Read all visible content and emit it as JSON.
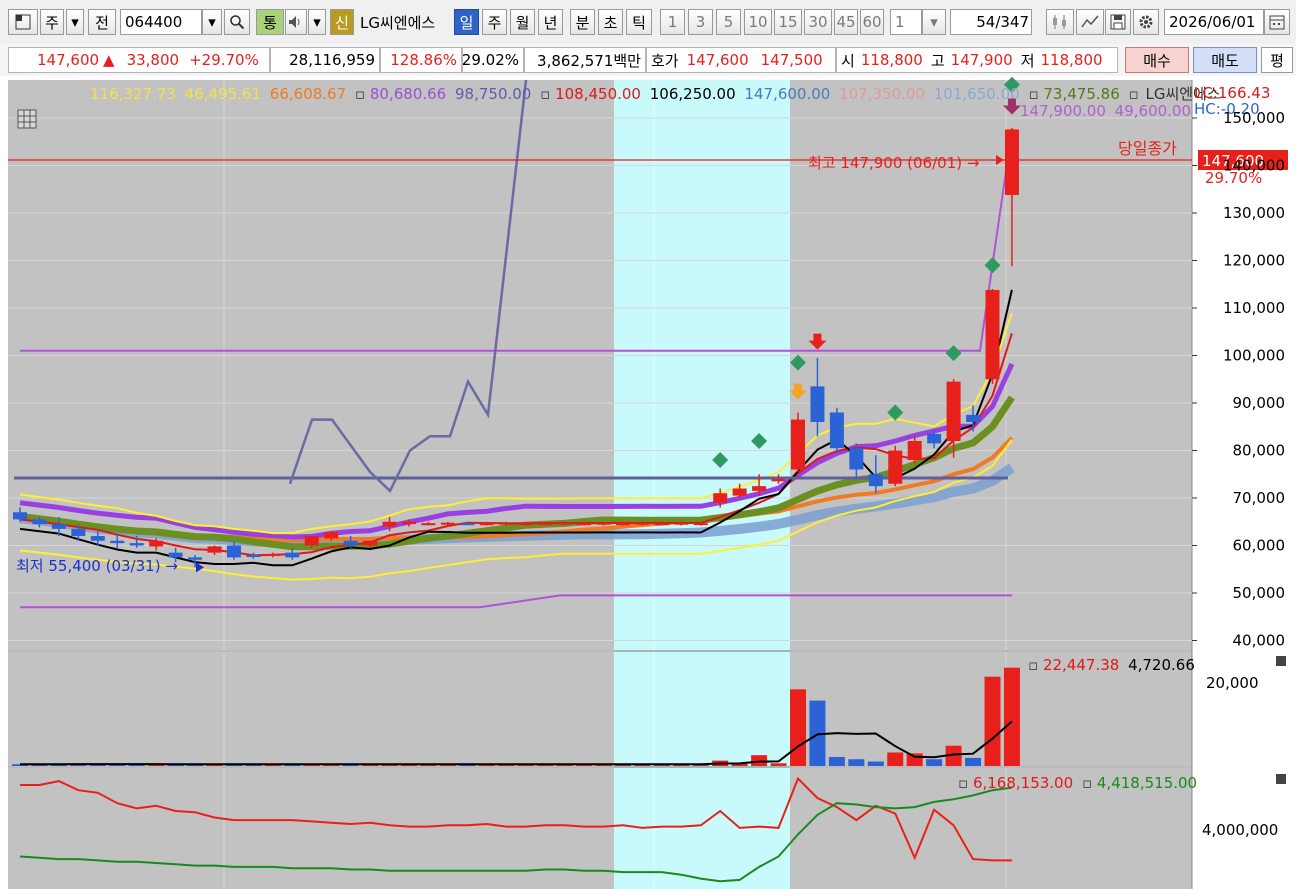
{
  "toolbar": {
    "market": "주",
    "prev": "전",
    "code": "064400",
    "tong": "통",
    "new": "신",
    "name": "LG씨엔에스",
    "periods": [
      "일",
      "주",
      "월",
      "년",
      "분",
      "초",
      "틱"
    ],
    "minutes": [
      "1",
      "3",
      "5",
      "10",
      "15",
      "30",
      "45",
      "60"
    ],
    "unit": "1",
    "count": "54",
    "total": "/347",
    "date": "2026/06/01"
  },
  "info": {
    "price": "147,600",
    "arrow": "▲",
    "change": "33,800",
    "rate": "+29.70%",
    "volume": "28,116,959",
    "vol_ratio": "128.86%",
    "turnover": "29.02%",
    "amount": "3,862,571백만",
    "quote_label": "호가",
    "ask": "147,600",
    "bid": "147,500",
    "open_label": "시",
    "open": "118,800",
    "high_label": "고",
    "high": "147,900",
    "low_label": "저",
    "low": "118,800",
    "buy": "매수",
    "sell": "매도",
    "avg": "평"
  },
  "legend": {
    "v1": "116,327.73",
    "v2": "46,495.61",
    "v3": "66,608.67",
    "v4": "80,680.66",
    "v5": "98,750.00",
    "v6": "108,450.00",
    "v7": "106,250.00",
    "v8": "147,600.00",
    "v9": "107,350.00",
    "v10": "101,650.00",
    "v11": "73,475.86",
    "name": "LG씨엔에스",
    "lc": "LC:166.43",
    "hc": "HC:-0.20",
    "env_hi": "147,900.00",
    "env_lo": "49,600.00",
    "close_today": "당일종가"
  },
  "price_axis": [
    "150,000",
    "140,000",
    "130,000",
    "120,000",
    "110,000",
    "100,000",
    "90,000",
    "80,000",
    "70,000",
    "60,000",
    "50,000",
    "40,000"
  ],
  "annotations": {
    "high": "최고 147,900 (06/01) →",
    "low": "최저 55,400 (03/31) →",
    "last_price": "147,600",
    "last_rate": "29.70%"
  },
  "volume_panel": {
    "v1": "22,447.38",
    "v2": "4,720.66",
    "axis": "20,000"
  },
  "flow_panel": {
    "v1": "6,168,153.00",
    "v2": "4,418,515.00",
    "axis": "4,000,000"
  },
  "colors": {
    "up": "#e8201c",
    "down": "#2b63d6",
    "bg_chart": "#c2c2c2",
    "highlight": "#c8f9fb"
  },
  "chart_data": {
    "type": "candlestick",
    "ylim": [
      38000,
      158000
    ],
    "candles": [
      {
        "o": 67000,
        "h": 68000,
        "c": 65500,
        "l": 65000
      },
      {
        "o": 65500,
        "h": 66000,
        "c": 64500,
        "l": 63800
      },
      {
        "o": 64500,
        "h": 66000,
        "c": 63500,
        "l": 62000
      },
      {
        "o": 63500,
        "h": 64500,
        "c": 62000,
        "l": 61000
      },
      {
        "o": 62000,
        "h": 63000,
        "c": 61000,
        "l": 60000
      },
      {
        "o": 61000,
        "h": 62500,
        "c": 60500,
        "l": 59500
      },
      {
        "o": 60500,
        "h": 62000,
        "c": 60000,
        "l": 59500
      },
      {
        "o": 59800,
        "h": 61500,
        "c": 61000,
        "l": 59000
      },
      {
        "o": 58500,
        "h": 59500,
        "c": 57500,
        "l": 56500
      },
      {
        "o": 57500,
        "h": 58000,
        "c": 57000,
        "l": 55400
      },
      {
        "o": 58500,
        "h": 60000,
        "c": 59800,
        "l": 58000
      },
      {
        "o": 60000,
        "h": 61000,
        "c": 57500,
        "l": 57000
      },
      {
        "o": 58000,
        "h": 58500,
        "c": 57800,
        "l": 57200
      },
      {
        "o": 58000,
        "h": 58500,
        "c": 58200,
        "l": 57500
      },
      {
        "o": 58500,
        "h": 59500,
        "c": 57500,
        "l": 57000
      },
      {
        "o": 60000,
        "h": 62000,
        "c": 62000,
        "l": 59500
      },
      {
        "o": 61500,
        "h": 63000,
        "c": 62800,
        "l": 61000
      },
      {
        "o": 61000,
        "h": 62000,
        "c": 60000,
        "l": 59500
      },
      {
        "o": 60000,
        "h": 61000,
        "c": 61000,
        "l": 59500
      },
      {
        "o": 64000,
        "h": 66000,
        "c": 65000,
        "l": 63000
      },
      {
        "o": 64500,
        "h": 65500,
        "c": 65000,
        "l": 64000
      },
      {
        "o": 64500,
        "h": 65000,
        "c": 64700,
        "l": 64200
      },
      {
        "o": 64500,
        "h": 65000,
        "c": 64800,
        "l": 64200
      },
      {
        "o": 64700,
        "h": 65000,
        "c": 64500,
        "l": 64300
      },
      {
        "o": 64500,
        "h": 65000,
        "c": 64700,
        "l": 64200
      },
      {
        "o": 64500,
        "h": 65000,
        "c": 64800,
        "l": 64200
      },
      {
        "o": 64500,
        "h": 65000,
        "c": 64700,
        "l": 64200
      },
      {
        "o": 64500,
        "h": 65000,
        "c": 64700,
        "l": 64200
      },
      {
        "o": 64500,
        "h": 65000,
        "c": 64800,
        "l": 64200
      },
      {
        "o": 64500,
        "h": 65000,
        "c": 64700,
        "l": 64200
      },
      {
        "o": 64500,
        "h": 65000,
        "c": 64800,
        "l": 64200
      },
      {
        "o": 64500,
        "h": 65000,
        "c": 64700,
        "l": 64200
      },
      {
        "o": 64500,
        "h": 65000,
        "c": 64800,
        "l": 64200
      },
      {
        "o": 64500,
        "h": 65000,
        "c": 64700,
        "l": 64200
      },
      {
        "o": 64500,
        "h": 65000,
        "c": 64800,
        "l": 64200
      },
      {
        "o": 64500,
        "h": 65000,
        "c": 64700,
        "l": 64200
      },
      {
        "o": 69000,
        "h": 72000,
        "c": 71000,
        "l": 68000
      },
      {
        "o": 70500,
        "h": 73000,
        "c": 72000,
        "l": 70000
      },
      {
        "o": 71500,
        "h": 75000,
        "c": 72500,
        "l": 70500
      },
      {
        "o": 73500,
        "h": 75000,
        "c": 74000,
        "l": 73000
      },
      {
        "o": 76000,
        "h": 88000,
        "c": 86500,
        "l": 75500
      },
      {
        "o": 93500,
        "h": 99500,
        "c": 86000,
        "l": 83000
      },
      {
        "o": 88000,
        "h": 89000,
        "c": 80500,
        "l": 79500
      },
      {
        "o": 80500,
        "h": 81500,
        "c": 76000,
        "l": 74000
      },
      {
        "o": 75000,
        "h": 79000,
        "c": 72500,
        "l": 71000
      },
      {
        "o": 73000,
        "h": 81000,
        "c": 80000,
        "l": 72500
      },
      {
        "o": 78000,
        "h": 83000,
        "c": 82000,
        "l": 77000
      },
      {
        "o": 83500,
        "h": 84500,
        "c": 81500,
        "l": 80500
      },
      {
        "o": 82000,
        "h": 95000,
        "c": 94500,
        "l": 78500
      },
      {
        "o": 87500,
        "h": 89500,
        "c": 86000,
        "l": 84000
      },
      {
        "o": 95000,
        "h": 114000,
        "c": 113800,
        "l": 94000
      },
      {
        "o": 133800,
        "h": 147900,
        "c": 147600,
        "l": 118800
      }
    ],
    "volume": [
      400,
      400,
      400,
      500,
      400,
      400,
      400,
      400,
      400,
      400,
      400,
      400,
      400,
      400,
      400,
      400,
      400,
      400,
      400,
      400,
      400,
      400,
      400,
      400,
      400,
      400,
      400,
      400,
      400,
      400,
      400,
      400,
      400,
      400,
      400,
      400,
      1200,
      500,
      2400,
      600,
      17000,
      14500,
      2000,
      1500,
      1000,
      3000,
      2800,
      1500,
      4500,
      1800,
      19800,
      21800
    ],
    "flow_red": [
      9000,
      9000,
      9300,
      8600,
      8400,
      7600,
      7200,
      7400,
      7000,
      6900,
      6500,
      6300,
      6300,
      6300,
      6300,
      6200,
      6100,
      6000,
      6100,
      5900,
      5800,
      5800,
      5900,
      5900,
      6000,
      5800,
      5800,
      5900,
      5900,
      5800,
      5800,
      5900,
      5700,
      5800,
      5800,
      5900,
      7000,
      5700,
      5800,
      5700,
      9500,
      8000,
      7300,
      6300,
      7400,
      6800,
      3400,
      7100,
      5900,
      3300,
      3200,
      3200
    ],
    "flow_green": [
      3500,
      3400,
      3300,
      3300,
      3200,
      3100,
      3100,
      3000,
      2900,
      2800,
      2800,
      2700,
      2700,
      2700,
      2600,
      2600,
      2600,
      2500,
      2500,
      2400,
      2400,
      2400,
      2400,
      2400,
      2400,
      2400,
      2400,
      2500,
      2500,
      2400,
      2400,
      2300,
      2300,
      2300,
      2100,
      1800,
      1600,
      1700,
      2700,
      3500,
      5200,
      6700,
      7600,
      7500,
      7300,
      7200,
      7300,
      7700,
      7900,
      8200,
      8600,
      8800
    ]
  }
}
